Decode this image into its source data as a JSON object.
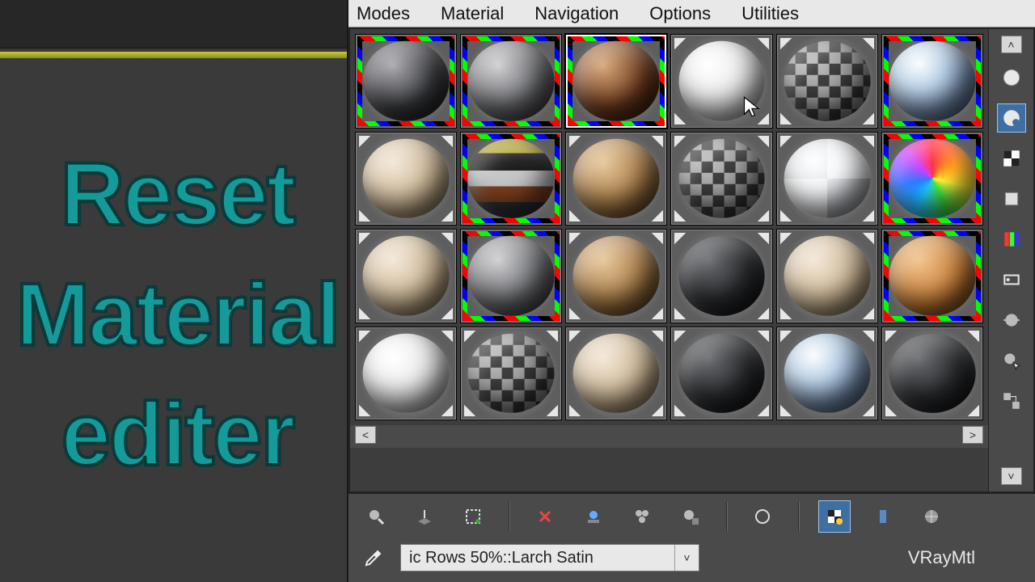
{
  "overlay": {
    "line1": "Reset",
    "line2": "Material",
    "line3": "editer"
  },
  "menubar": [
    "Modes",
    "Material",
    "Navigation",
    "Options",
    "Utilities"
  ],
  "slots": [
    {
      "color": "darkgray",
      "rgb": true,
      "corners": false,
      "selected": false
    },
    {
      "color": "gray",
      "rgb": true,
      "corners": false,
      "selected": false
    },
    {
      "color": "brown",
      "rgb": true,
      "corners": false,
      "selected": true
    },
    {
      "color": "white",
      "rgb": false,
      "corners": true,
      "selected": false,
      "cursor": true
    },
    {
      "color": "checker",
      "rgb": false,
      "corners": true,
      "selected": false
    },
    {
      "color": "glass",
      "rgb": true,
      "corners": false,
      "selected": false
    },
    {
      "color": "cream",
      "rgb": false,
      "corners": true,
      "selected": false
    },
    {
      "color": "multi",
      "rgb": true,
      "corners": false,
      "selected": false
    },
    {
      "color": "tan",
      "rgb": false,
      "corners": true,
      "selected": false
    },
    {
      "color": "checker",
      "rgb": false,
      "corners": true,
      "selected": false
    },
    {
      "color": "chrome",
      "rgb": false,
      "corners": true,
      "selected": false
    },
    {
      "color": "rainbow",
      "rgb": true,
      "corners": false,
      "selected": false
    },
    {
      "color": "cream",
      "rgb": false,
      "corners": true,
      "selected": false
    },
    {
      "color": "gray",
      "rgb": true,
      "corners": false,
      "selected": false
    },
    {
      "color": "tan",
      "rgb": false,
      "corners": true,
      "selected": false
    },
    {
      "color": "black",
      "rgb": false,
      "corners": true,
      "selected": false
    },
    {
      "color": "cream",
      "rgb": false,
      "corners": true,
      "selected": false
    },
    {
      "color": "orange",
      "rgb": true,
      "corners": false,
      "selected": false
    },
    {
      "color": "white",
      "rgb": false,
      "corners": true,
      "selected": false
    },
    {
      "color": "checker",
      "rgb": false,
      "corners": true,
      "selected": false
    },
    {
      "color": "cream",
      "rgb": false,
      "corners": true,
      "selected": false
    },
    {
      "color": "black",
      "rgb": false,
      "corners": true,
      "selected": false
    },
    {
      "color": "glass",
      "rgb": false,
      "corners": true,
      "selected": false
    },
    {
      "color": "black",
      "rgb": false,
      "corners": true,
      "selected": false
    }
  ],
  "side_tools": [
    {
      "name": "sample-type-icon",
      "selected": false
    },
    {
      "name": "sample-uv-tiling-icon",
      "selected": true
    },
    {
      "name": "background-checker-icon",
      "selected": false
    },
    {
      "name": "backlight-icon",
      "selected": false
    },
    {
      "name": "color-check-icon",
      "selected": false
    },
    {
      "name": "video-preview-icon",
      "selected": false
    },
    {
      "name": "options-icon",
      "selected": false
    },
    {
      "name": "select-by-material-icon",
      "selected": false
    },
    {
      "name": "material-map-nav-icon",
      "selected": false
    }
  ],
  "bottom_toolbar": [
    {
      "name": "get-material-icon"
    },
    {
      "name": "put-to-scene-icon"
    },
    {
      "name": "assign-to-selection-icon"
    },
    {
      "name": "reset-map-icon"
    },
    {
      "name": "put-to-library-icon"
    },
    {
      "name": "material-id-icon"
    },
    {
      "name": "show-in-viewport-icon"
    },
    {
      "name": "show-end-result-icon"
    },
    {
      "name": "go-to-parent-icon",
      "selected": true
    },
    {
      "name": "go-forward-icon"
    },
    {
      "name": "pick-material-icon"
    }
  ],
  "scroll": {
    "left": "<",
    "right": ">",
    "up": "˄",
    "down": "˅"
  },
  "material_name": {
    "value": "ic Rows 50%::Larch Satin",
    "dropdown": "˅"
  },
  "material_type": "VRayMtl",
  "colors": {
    "accent": "#159a9a",
    "selection": "#3e6fa3"
  }
}
